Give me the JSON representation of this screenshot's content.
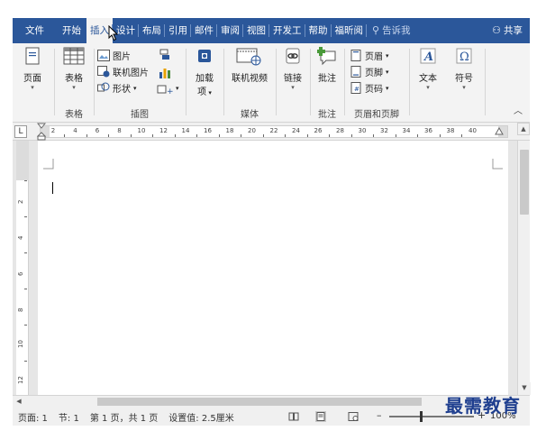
{
  "tabs": [
    {
      "label": "文件"
    },
    {
      "label": "开始"
    },
    {
      "label": "插入",
      "active": true
    },
    {
      "label": "设计"
    },
    {
      "label": "布局"
    },
    {
      "label": "引用"
    },
    {
      "label": "邮件"
    },
    {
      "label": "审阅"
    },
    {
      "label": "视图"
    },
    {
      "label": "开发工"
    },
    {
      "label": "帮助"
    },
    {
      "label": "福昕阅"
    }
  ],
  "tell_me": "告诉我",
  "share": "共享",
  "ribbon": {
    "pages": {
      "button": "页面"
    },
    "tables": {
      "button": "表格",
      "group": "表格"
    },
    "illustrations": {
      "group": "插图",
      "pictures": "图片",
      "online_pictures": "联机图片",
      "shapes": "形状"
    },
    "addins": {
      "button_line1": "加载",
      "button_line2": "项"
    },
    "media": {
      "button": "联机视频",
      "group": "媒体"
    },
    "links": {
      "button": "链接"
    },
    "comments": {
      "button": "批注",
      "group": "批注"
    },
    "header_footer": {
      "group": "页眉和页脚",
      "header": "页眉",
      "footer": "页脚",
      "page_number": "页码"
    },
    "text": {
      "button": "文本"
    },
    "symbols": {
      "button": "符号"
    }
  },
  "ruler_numbers": [
    "2",
    "4",
    "6",
    "8",
    "10",
    "12",
    "14",
    "16",
    "18",
    "20",
    "22",
    "24",
    "26",
    "28",
    "30",
    "32",
    "34",
    "36",
    "38",
    "40"
  ],
  "vruler_numbers": [
    "2",
    "4",
    "6",
    "8",
    "10",
    "12"
  ],
  "tab_selector": "L",
  "status": {
    "page": "页面: 1",
    "section": "节: 1",
    "page_of": "第 1 页，共 1 页",
    "setting": "设置值: 2.5厘米",
    "zoom": "100%"
  },
  "watermark": "最需教育",
  "colors": {
    "accent": "#2b579a",
    "ribbon_bg": "#f3f3f3"
  }
}
